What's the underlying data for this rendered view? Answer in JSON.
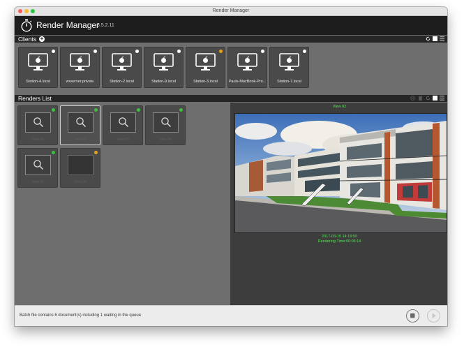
{
  "window": {
    "title": "Render Manager"
  },
  "app": {
    "name": "Render Manager",
    "version": "6.5.2.11"
  },
  "clients_section": {
    "title": "Clients"
  },
  "clients": [
    {
      "name": "Station-4.local",
      "status_color": "#ffffff"
    },
    {
      "name": "wsserver.private",
      "status_color": "#ffffff"
    },
    {
      "name": "Station-2.local",
      "status_color": "#ffffff"
    },
    {
      "name": "Station-9.local",
      "status_color": "#ffffff"
    },
    {
      "name": "Station-3.local",
      "status_color": "#e8a020"
    },
    {
      "name": "Pauls-MacBook-Pro...",
      "status_color": "#ffffff"
    },
    {
      "name": "Station-7.local",
      "status_color": "#ffffff"
    }
  ],
  "renders_section": {
    "title": "Renders List"
  },
  "renders": [
    {
      "label": "View 01",
      "status_color": "#3fbf3f",
      "selected": false
    },
    {
      "label": "View 02",
      "status_color": "#3fbf3f",
      "selected": true
    },
    {
      "label": "View 03",
      "status_color": "#3fbf3f",
      "selected": false
    },
    {
      "label": "View 04",
      "status_color": "#3fbf3f",
      "selected": false
    },
    {
      "label": "View 05",
      "status_color": "#3fbf3f",
      "selected": false
    },
    {
      "label": "View 06",
      "status_color": "#e8a020",
      "selected": false
    }
  ],
  "preview": {
    "caption": "View 02",
    "date": "2017-03-15 14:19:50",
    "render_time": "Rendering Time:00:06:14"
  },
  "footer": {
    "status": "Batch file contains 6 document(s) including 1 waiting in the queue"
  },
  "colors": {
    "accent_green": "#58e058",
    "status_green": "#3fbf3f",
    "status_orange": "#e8a020"
  },
  "icons": [
    "stopwatch-icon",
    "add-icon",
    "refresh-icon",
    "grid-view-icon",
    "list-view-icon",
    "monitor-icon",
    "magnifier-icon",
    "trash-icon",
    "stop-icon",
    "play-icon"
  ]
}
